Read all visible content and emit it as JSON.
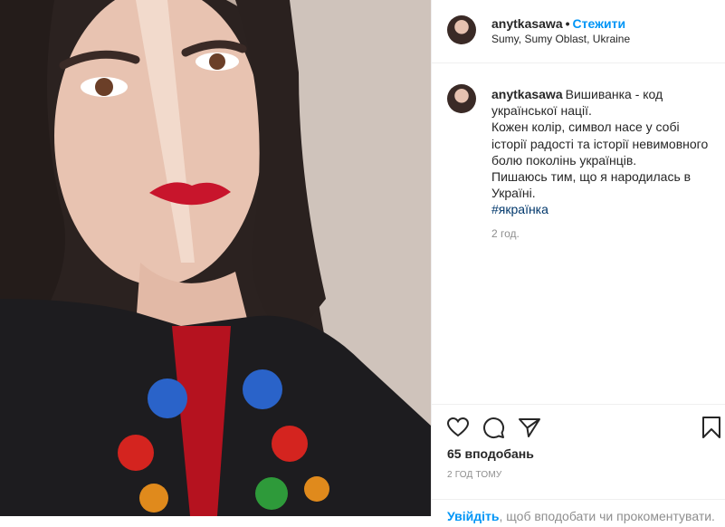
{
  "post": {
    "username": "anytkasawa",
    "follow_label": "Стежити",
    "location": "Sumy, Sumy Oblast, Ukraine",
    "caption_lines": [
      "Вишиванка - код",
      "української нації.",
      "Кожен колір, символ насе у собі",
      "історії радості та історії невимовного",
      "болю поколінь українців.",
      "Пишаюсь тим, що я народилась в",
      "Україні."
    ],
    "hashtag": "#якраїнка",
    "caption_time": "2 год.",
    "likes": "65 вподобань",
    "time_ago": "2 ГОД ТОМУ",
    "login_link": "Увійдіть",
    "login_rest": ", щоб вподобати чи прокоментувати."
  },
  "icons": {
    "like": "heart-icon",
    "comment": "comment-icon",
    "share": "share-icon",
    "save": "bookmark-icon"
  },
  "colors": {
    "accent": "#0095f6",
    "hashtag": "#00376b",
    "muted": "#8e8e8e"
  }
}
